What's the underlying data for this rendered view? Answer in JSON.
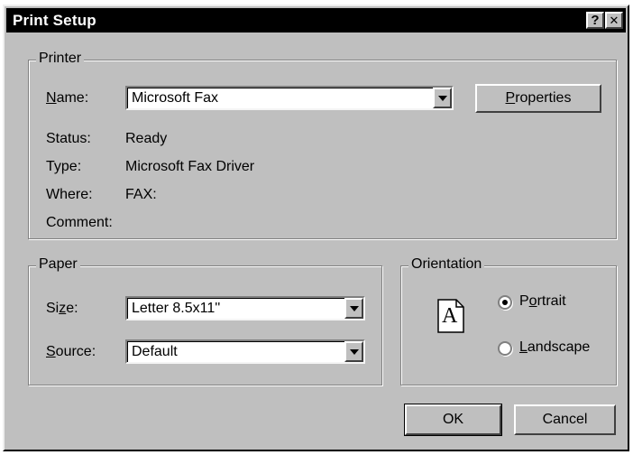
{
  "window": {
    "title": "Print Setup",
    "help_glyph": "?",
    "close_glyph": "✕"
  },
  "printer": {
    "group_label": "Printer",
    "name_label_mnemonic": "N",
    "name_label_rest": "ame:",
    "name_value": "Microsoft Fax",
    "properties_mnemonic": "P",
    "properties_rest": "roperties",
    "status_label": "Status:",
    "status_value": "Ready",
    "type_label": "Type:",
    "type_value": "Microsoft Fax Driver",
    "where_label": "Where:",
    "where_value": "FAX:",
    "comment_label": "Comment:",
    "comment_value": ""
  },
  "paper": {
    "group_label": "Paper",
    "size_label_pre": "Si",
    "size_label_mnemonic": "z",
    "size_label_post": "e:",
    "size_value": "Letter 8.5x11''",
    "source_label_mnemonic": "S",
    "source_label_rest": "ource:",
    "source_value": "Default"
  },
  "orientation": {
    "group_label": "Orientation",
    "page_glyph": "A",
    "portrait_pre": "P",
    "portrait_mnemonic": "o",
    "portrait_post": "rtrait",
    "landscape_mnemonic": "L",
    "landscape_rest": "andscape",
    "selected": "portrait"
  },
  "buttons": {
    "ok": "OK",
    "cancel": "Cancel"
  }
}
